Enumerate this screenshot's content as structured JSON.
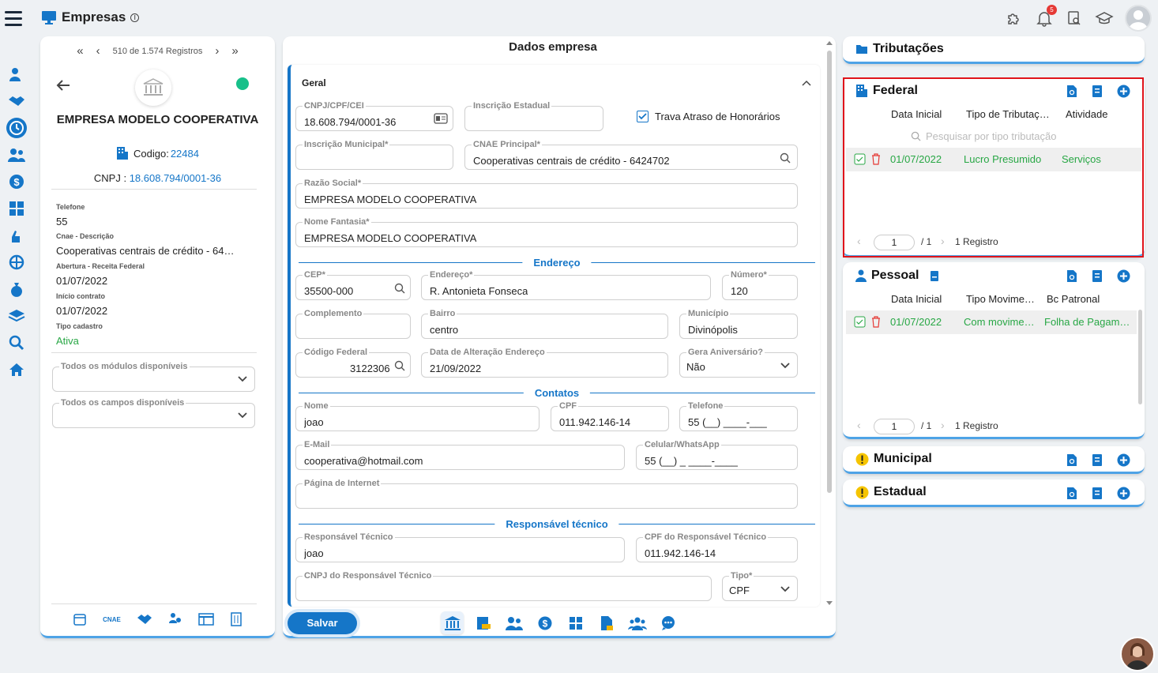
{
  "app": {
    "title": "Empresas",
    "notifications_count": "5"
  },
  "left": {
    "pager_text": "510 de 1.574 Registros",
    "company_name": "EMPRESA MODELO COOPERATIVA",
    "codigo_label": "Codigo:",
    "codigo_value": "22484",
    "cnpj_label": "CNPJ :",
    "cnpj_value": "18.608.794/0001-36",
    "status_color": "#18c08a",
    "info": [
      {
        "label": "Telefone",
        "value": "55"
      },
      {
        "label": "Cnae - Descrição",
        "value": "Cooperativas centrais de crédito - 64…"
      },
      {
        "label": "Abertura - Receita Federal",
        "value": "01/07/2022"
      },
      {
        "label": "Início contrato",
        "value": "01/07/2022"
      },
      {
        "label": "Tipo cadastro",
        "value": "Ativa"
      }
    ],
    "select_modules_label": "Todos os módulos disponíveis",
    "select_fields_label": "Todos os campos disponíveis",
    "footer_cnae": "CNAE"
  },
  "form": {
    "title": "Dados empresa",
    "section_geral": "Geral",
    "cnpj": {
      "label": "CNPJ/CPF/CEI",
      "value": "18.608.794/0001-36"
    },
    "ie": {
      "label": "Inscrição Estadual",
      "value": ""
    },
    "trava_label": "Trava Atraso de Honorários",
    "im": {
      "label": "Inscrição Municipal*",
      "value": ""
    },
    "cnae": {
      "label": "CNAE Principal*",
      "value": "Cooperativas centrais de crédito - 6424702"
    },
    "razao": {
      "label": "Razão Social*",
      "value": "EMPRESA MODELO COOPERATIVA"
    },
    "fantasia": {
      "label": "Nome Fantasia*",
      "value": "EMPRESA MODELO COOPERATIVA"
    },
    "section_endereco": "Endereço",
    "cep": {
      "label": "CEP*",
      "value": "35500-000"
    },
    "endereco": {
      "label": "Endereço*",
      "value": "R. Antonieta Fonseca"
    },
    "numero": {
      "label": "Número*",
      "value": "120"
    },
    "complemento": {
      "label": "Complemento",
      "value": ""
    },
    "bairro": {
      "label": "Bairro",
      "value": "centro"
    },
    "municipio": {
      "label": "Município",
      "value": "Divinópolis"
    },
    "cod_federal": {
      "label": "Código Federal",
      "value": "3122306"
    },
    "data_alt": {
      "label": "Data de Alteração Endereço",
      "value": "21/09/2022"
    },
    "gera_aniv": {
      "label": "Gera Aniversário?",
      "value": "Não"
    },
    "section_contatos": "Contatos",
    "nome": {
      "label": "Nome",
      "value": "joao"
    },
    "cpf": {
      "label": "CPF",
      "value": "011.942.146-14"
    },
    "telefone": {
      "label": "Telefone",
      "value": "55 (__) ____-___"
    },
    "email": {
      "label": "E-Mail",
      "value": "cooperativa@hotmail.com"
    },
    "celular": {
      "label": "Celular/WhatsApp",
      "value": "55 (__) _ ____-____"
    },
    "pagina": {
      "label": "Página de Internet",
      "value": ""
    },
    "section_resp": "Responsável técnico",
    "resp": {
      "label": "Responsável Técnico",
      "value": "joao"
    },
    "cpf_resp": {
      "label": "CPF do Responsável Técnico",
      "value": "011.942.146-14"
    },
    "cnpj_resp": {
      "label": "CNPJ do Responsável Técnico",
      "value": ""
    },
    "tipo": {
      "label": "Tipo*",
      "value": "CPF"
    },
    "save_label": "Salvar"
  },
  "right": {
    "tributacoes_title": "Tributações",
    "federal": {
      "title": "Federal",
      "columns": [
        "Data Inicial",
        "Tipo de Tributaç…",
        "Atividade"
      ],
      "search_placeholder": "Pesquisar por tipo tributação",
      "rows": [
        {
          "data": "01/07/2022",
          "tipo": "Lucro Presumido",
          "atividade": "Serviços"
        }
      ],
      "page_value": "1",
      "page_total": "/ 1",
      "records": "1 Registro"
    },
    "pessoal": {
      "title": "Pessoal",
      "columns": [
        "Data Inicial",
        "Tipo Movime…",
        "Bc Patronal"
      ],
      "rows": [
        {
          "data": "01/07/2022",
          "tipo": "Com movime…",
          "bc": "Folha de Pagam…"
        }
      ],
      "page_value": "1",
      "page_total": "/ 1",
      "records": "1 Registro"
    },
    "municipal_title": "Municipal",
    "estadual_title": "Estadual"
  },
  "colors": {
    "accent": "#1576c8",
    "success": "#28a745",
    "highlight": "#e0141b"
  }
}
